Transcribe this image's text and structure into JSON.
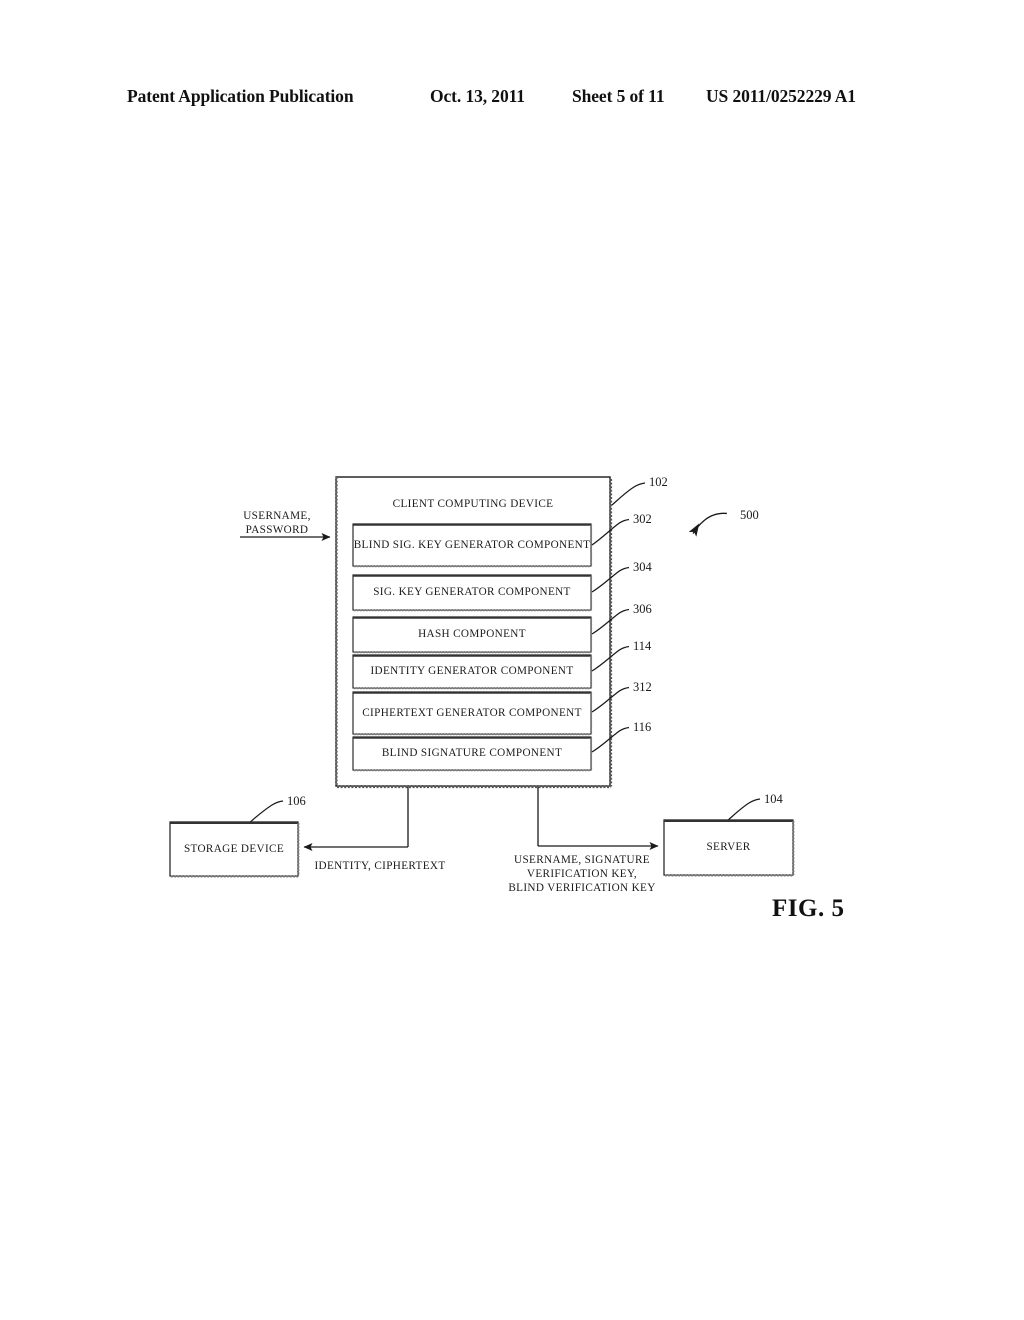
{
  "header": {
    "title": "Patent Application Publication",
    "date": "Oct. 13, 2011",
    "sheet": "Sheet 5 of 11",
    "publication_number": "US 2011/0252229 A1"
  },
  "figure": {
    "caption": "FIG. 5",
    "figure_ref": "500",
    "client_box": {
      "title": "CLIENT COMPUTING DEVICE",
      "ref": "102",
      "components": [
        {
          "label": "BLIND SIG. KEY GENERATOR COMPONENT",
          "ref": "302"
        },
        {
          "label": "SIG. KEY GENERATOR COMPONENT",
          "ref": "304"
        },
        {
          "label": "HASH COMPONENT",
          "ref": "306"
        },
        {
          "label": "IDENTITY GENERATOR COMPONENT",
          "ref": "114"
        },
        {
          "label": "CIPHERTEXT GENERATOR COMPONENT",
          "ref": "312"
        },
        {
          "label": "BLIND SIGNATURE COMPONENT",
          "ref": "116"
        }
      ]
    },
    "storage_box": {
      "label": "STORAGE DEVICE",
      "ref": "106"
    },
    "server_box": {
      "label": "SERVER",
      "ref": "104"
    },
    "input_label": {
      "line1": "USERNAME,",
      "line2": "PASSWORD"
    },
    "storage_flow_label": "IDENTITY, CIPHERTEXT",
    "server_flow_label": {
      "line1": "USERNAME, SIGNATURE",
      "line2": "VERIFICATION KEY,",
      "line3": "BLIND VERIFICATION KEY"
    }
  },
  "colors": {
    "ink": "#1a1a1a",
    "paper": "#ffffff"
  }
}
